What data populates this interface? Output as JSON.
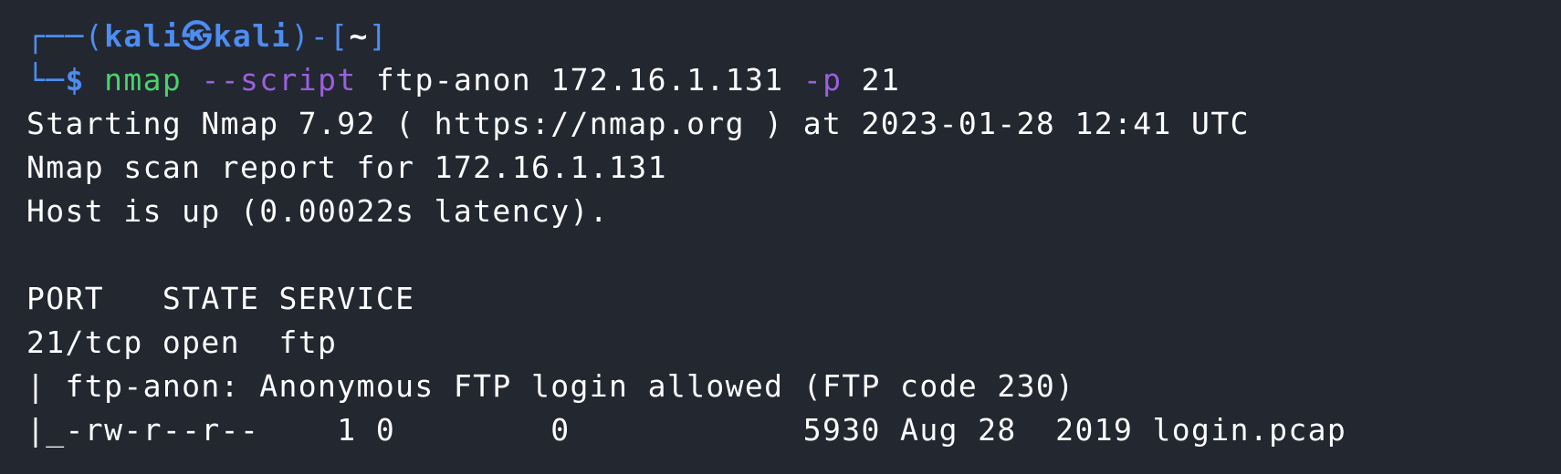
{
  "prompt": {
    "box_top": "┌──(",
    "user": "kali",
    "at_symbol": "㉿",
    "host": "kali",
    "close_paren": ")-[",
    "cwd": "~",
    "close_bracket": "]",
    "box_bottom": "└─",
    "dollar": "$"
  },
  "command": {
    "program": "nmap",
    "flag_script": "--script",
    "script_name": "ftp-anon",
    "target": "172.16.1.131",
    "flag_port": "-p",
    "port": "21"
  },
  "output": [
    "Starting Nmap 7.92 ( https://nmap.org ) at 2023-01-28 12:41 UTC",
    "Nmap scan report for 172.16.1.131",
    "Host is up (0.00022s latency).",
    "",
    "PORT   STATE SERVICE",
    "21/tcp open  ftp",
    "| ftp-anon: Anonymous FTP login allowed (FTP code 230)",
    "|_-rw-r--r--    1 0        0            5930 Aug 28  2019 login.pcap"
  ],
  "colors": {
    "background": "#232730",
    "prompt_blue": "#4d8df2",
    "command_green": "#47d46b",
    "flag_purple": "#9b5fe0",
    "text": "#ffffff"
  }
}
